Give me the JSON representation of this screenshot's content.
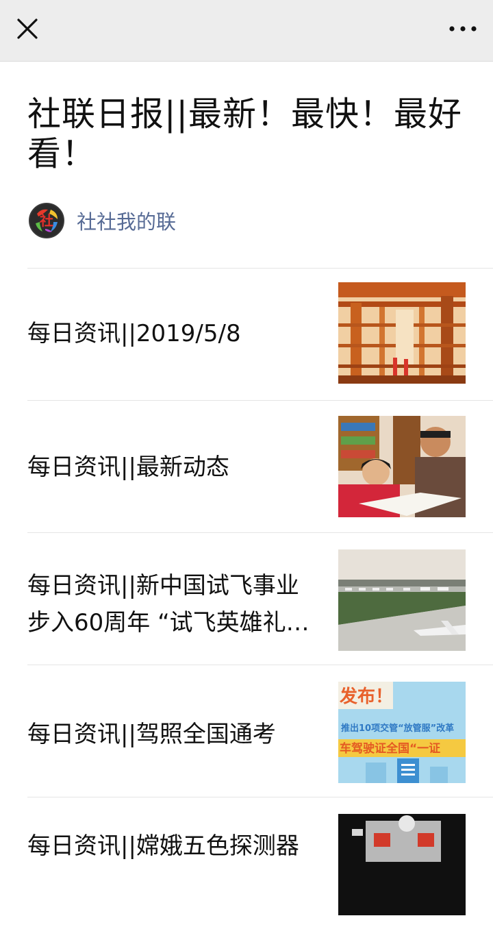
{
  "nav": {
    "close_icon": "close-icon",
    "more_icon": "more-horizontal-icon"
  },
  "article": {
    "title": "社联日报||最新！最快！最好看！",
    "author": {
      "name": "社社我的联",
      "avatar_text": "社"
    }
  },
  "items": [
    {
      "title": "每日资讯||2019/5/8",
      "thumb": "industrial-pipes-image"
    },
    {
      "title": "每日资讯||最新动态",
      "thumb": "father-daughter-reading-image"
    },
    {
      "title": "每日资讯||新中国试飞事业步入60周年 “试飞英雄礼…",
      "thumb": "airfield-image"
    },
    {
      "title": "每日资讯||驾照全国通考",
      "thumb": "driver-license-poster-image",
      "thumb_text_1": "发布！",
      "thumb_text_2": "推出10项交管“放管服”改革",
      "thumb_text_3": "车驾驶证全国“一证"
    },
    {
      "title": "每日资讯||嫦娥五色探测器",
      "thumb": "lunar-probe-image"
    }
  ],
  "colors": {
    "topbar": "#ededed",
    "link": "#576b95",
    "divider": "#e5e5e5"
  }
}
